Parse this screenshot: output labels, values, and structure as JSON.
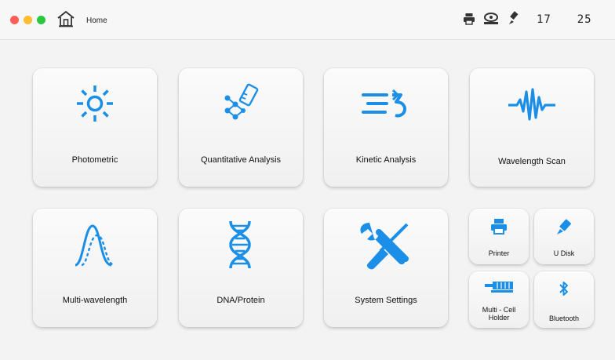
{
  "topbar": {
    "home_label": "Home",
    "time_hour": "17",
    "time_minute": "25",
    "window_dots": [
      "#ff5f57",
      "#febc2e",
      "#28c840"
    ],
    "status_icons": [
      "printer-icon",
      "multi-cell-holder-icon",
      "usb-icon"
    ]
  },
  "tiles": {
    "photometric": "Photometric",
    "quantitative": "Quantitative Analysis",
    "kinetic": "Kinetic Analysis",
    "wavelength_scan": "Wavelength Scan",
    "multi_wavelength": "Multi-wavelength",
    "dna_protein": "DNA/Protein",
    "system_settings": "System Settings",
    "printer": "Printer",
    "u_disk": "U Disk",
    "multi_cell_holder_line1": "Multi - Cell",
    "multi_cell_holder_line2": "Holder",
    "bluetooth": "Bluetooth"
  },
  "colors": {
    "accent": "#1b8fe8",
    "background": "#f3f3f3"
  }
}
